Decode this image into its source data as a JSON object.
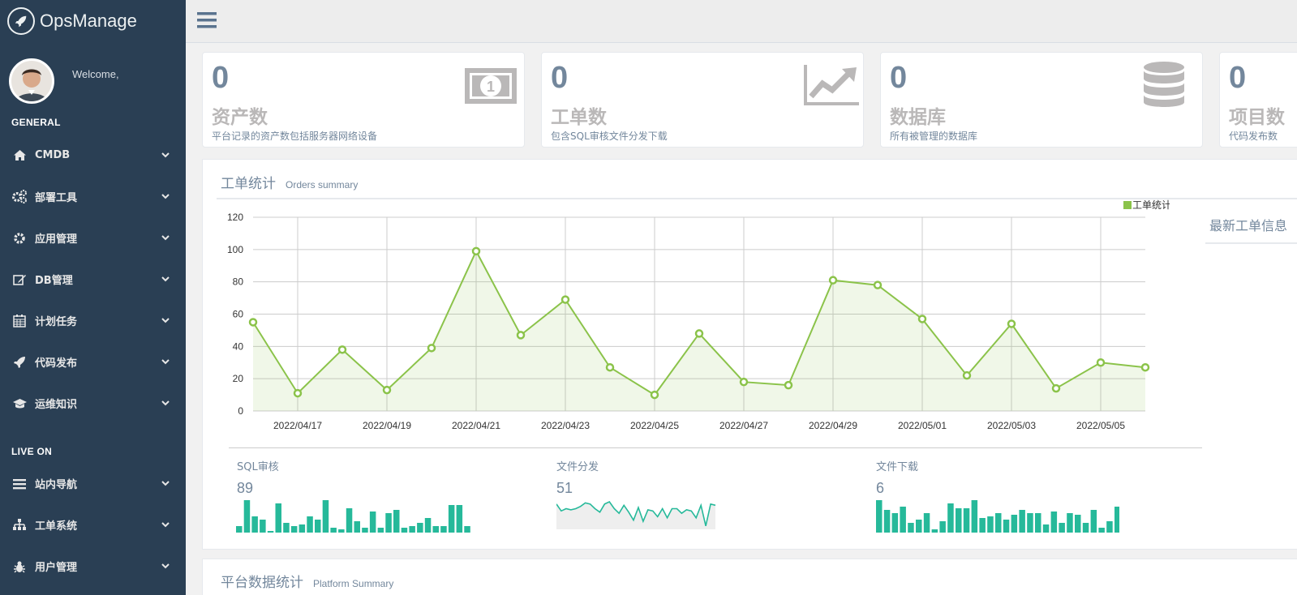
{
  "brand": {
    "name": "OpsManage"
  },
  "profile": {
    "welcome": "Welcome,"
  },
  "sidebar": {
    "general_title": "GENERAL",
    "live_title": "LIVE ON",
    "general_items": [
      {
        "label": "CMDB",
        "icon": "home-icon"
      },
      {
        "label": "部署工具",
        "icon": "cogs-icon"
      },
      {
        "label": "应用管理",
        "icon": "gear-icon"
      },
      {
        "label": "DB管理",
        "icon": "edit-icon"
      },
      {
        "label": "计划任务",
        "icon": "calendar-icon"
      },
      {
        "label": "代码发布",
        "icon": "rocket-icon"
      },
      {
        "label": "运维知识",
        "icon": "graduation-cap-icon"
      }
    ],
    "live_items": [
      {
        "label": "站内导航",
        "icon": "bars-icon"
      },
      {
        "label": "工单系统",
        "icon": "sitemap-icon"
      },
      {
        "label": "用户管理",
        "icon": "bug-icon"
      }
    ]
  },
  "tiles": [
    {
      "count": "0",
      "title": "资产数",
      "desc": "平台记录的资产数包括服务器网络设备",
      "icon": "money-icon"
    },
    {
      "count": "0",
      "title": "工单数",
      "desc": "包含SQL审核文件分发下载",
      "icon": "line-chart-icon"
    },
    {
      "count": "0",
      "title": "数据库",
      "desc": "所有被管理的数据库",
      "icon": "database-icon"
    },
    {
      "count": "0",
      "title": "项目数",
      "desc": "代码发布数",
      "icon": "project-icon"
    }
  ],
  "orders_panel": {
    "title": "工单统计",
    "subtitle": "Orders summary",
    "side_title": "最新工单信息"
  },
  "platform_panel": {
    "title": "平台数据统计",
    "subtitle": "Platform Summary"
  },
  "stats": [
    {
      "label": "SQL审核",
      "value": "89"
    },
    {
      "label": "文件分发",
      "value": "51"
    },
    {
      "label": "文件下载",
      "value": "6"
    }
  ],
  "colors": {
    "sidebar": "#2a3f54",
    "line": "#8bc34a",
    "spark": "#26b99a",
    "text": "#73879c"
  },
  "chart_data": {
    "type": "area",
    "title": "",
    "xlabel": "",
    "ylabel": "",
    "legend": [
      "工单统计"
    ],
    "legend_position": "top-right",
    "ylim": [
      0,
      120
    ],
    "yticks": [
      0,
      20,
      40,
      60,
      80,
      100,
      120
    ],
    "grid": true,
    "xticks": [
      "2022/04/17",
      "2022/04/19",
      "2022/04/21",
      "2022/04/23",
      "2022/04/25",
      "2022/04/27",
      "2022/04/29",
      "2022/05/01",
      "2022/05/03",
      "2022/05/05"
    ],
    "series": [
      {
        "name": "工单统计",
        "x": [
          "2022/04/16",
          "2022/04/17",
          "2022/04/18",
          "2022/04/19",
          "2022/04/20",
          "2022/04/21",
          "2022/04/22",
          "2022/04/23",
          "2022/04/24",
          "2022/04/25",
          "2022/04/26",
          "2022/04/27",
          "2022/04/28",
          "2022/04/29",
          "2022/04/30",
          "2022/05/01",
          "2022/05/02",
          "2022/05/03",
          "2022/05/04",
          "2022/05/05",
          "2022/05/06"
        ],
        "values": [
          55,
          11,
          38,
          13,
          39,
          99,
          47,
          69,
          27,
          10,
          48,
          18,
          16,
          81,
          78,
          57,
          22,
          54,
          14,
          30,
          27
        ]
      }
    ]
  },
  "sparklines": {
    "sql_bars": [
      4,
      20,
      10,
      8,
      1,
      18,
      6,
      4,
      5,
      10,
      8,
      20,
      3,
      2,
      15,
      7,
      3,
      13,
      3,
      12,
      14,
      3,
      4,
      6,
      9,
      4,
      4,
      17,
      17,
      4
    ],
    "file_dist_line": [
      22,
      16,
      18,
      17,
      18,
      20,
      23,
      22,
      18,
      15,
      22,
      24,
      18,
      14,
      21,
      15,
      8,
      19,
      7,
      17,
      16,
      11,
      18,
      10,
      18,
      18,
      14,
      17,
      16,
      10,
      21,
      3,
      22,
      21
    ],
    "file_dl_bars": [
      20,
      14,
      12,
      16,
      6,
      8,
      12,
      2,
      7,
      18,
      15,
      15,
      20,
      9,
      10,
      12,
      8,
      11,
      14,
      12,
      12,
      5,
      13,
      6,
      12,
      11,
      6,
      14,
      3,
      7,
      16,
      7
    ]
  }
}
